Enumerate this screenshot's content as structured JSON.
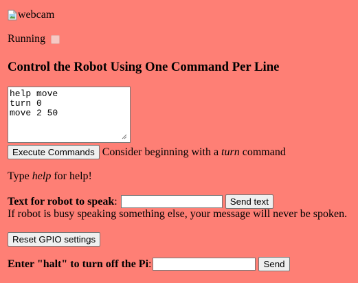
{
  "webcam": {
    "alt": "webcam"
  },
  "status": {
    "label": "Running",
    "checked": false
  },
  "heading": "Control the Robot Using One Command Per Line",
  "commands": {
    "value": "help move\nturn 0\nmove 2 50"
  },
  "execute": {
    "button_label": "Execute Commands",
    "hint_prefix": "Consider beginning with a ",
    "hint_em": "turn",
    "hint_suffix": " command"
  },
  "help_line": {
    "prefix": "Type ",
    "em": "help",
    "suffix": " for help!"
  },
  "speak": {
    "label": "Text for robot to speak",
    "colon": ":",
    "input_value": "",
    "button_label": "Send text",
    "note": "If robot is busy speaking something else, your message will never be spoken."
  },
  "reset": {
    "button_label": "Reset GPIO settings"
  },
  "halt": {
    "label": "Enter \"halt\" to turn off the Pi",
    "colon": ":",
    "input_value": "",
    "button_label": "Send"
  },
  "colors": {
    "background": "#fe7f75",
    "button_bg": "#efefef",
    "border": "#767676"
  }
}
